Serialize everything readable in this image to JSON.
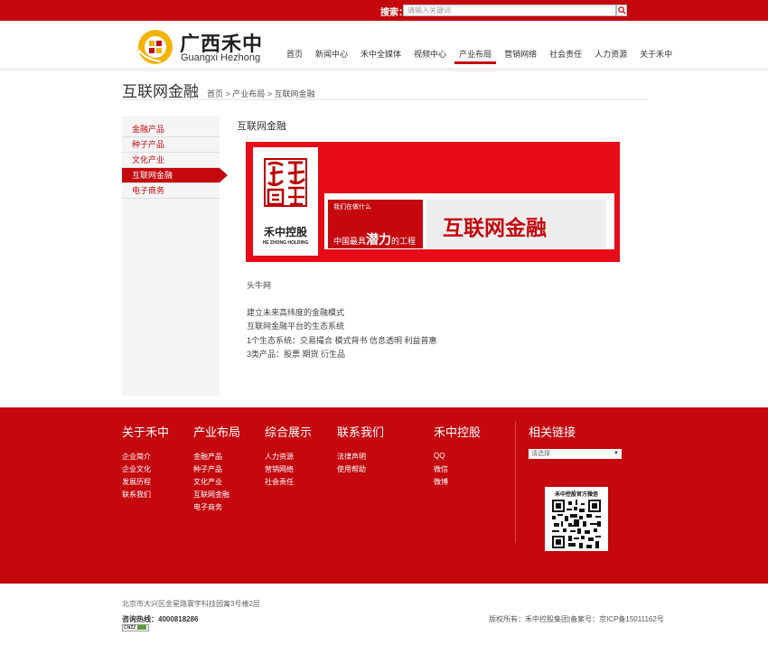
{
  "topbar": {
    "search_label": "搜索：",
    "search_placeholder": "请输入关键词"
  },
  "brand": {
    "name_cn": "广西禾中",
    "name_en": "Guangxi Hezhong",
    "color": "#c4080e",
    "logo_color": "#f2b304"
  },
  "nav": {
    "items": [
      "首页",
      "新闻中心",
      "禾中全媒体",
      "视频中心",
      "产业布局",
      "营销网络",
      "社会责任",
      "人力资源",
      "关于禾中"
    ],
    "active_index": 4
  },
  "page": {
    "heading": "互联网金融",
    "breadcrumb": "首页 > 产业布局 > 互联网金融"
  },
  "sidebar": {
    "items": [
      "金融产品",
      "种子产品",
      "文化产业",
      "互联网金融",
      "电子商务"
    ],
    "active_index": 3
  },
  "content": {
    "title": "互联网金融",
    "banner": {
      "seal_name": "禾中控股",
      "seal_en": "HE ZHONG HOLDING",
      "tag_top": "我们在做什么",
      "tag_main_prefix": "中国最具",
      "tag_main_emph": "潜力",
      "tag_main_suffix": "的工程",
      "headline": "互联网金融"
    },
    "paragraphs": [
      "头牛网",
      "建立未来高纬度的金融模式",
      "互联网金融平台的生态系统",
      "1个生态系统：交易撮合 模式背书 信息透明 利益普惠",
      "3类产品：股票 期货 衍生品"
    ]
  },
  "footer": {
    "columns": [
      {
        "title": "关于禾中",
        "links": [
          "企业简介",
          "企业文化",
          "发展历程",
          "联系我们"
        ]
      },
      {
        "title": "产业布局",
        "links": [
          "金融产品",
          "种子产品",
          "文化产业",
          "互联网金融",
          "电子商务"
        ]
      },
      {
        "title": "综合展示",
        "links": [
          "人力资源",
          "营销网络",
          "社会责任"
        ]
      },
      {
        "title": "联系我们",
        "links": [
          "法律声明",
          "使用帮助"
        ]
      },
      {
        "title": "禾中控股",
        "links": [
          "QQ",
          "微信",
          "微博"
        ]
      }
    ],
    "related_title": "相关链接",
    "select_value": "请选择",
    "qr_title": "禾中控股官方微信"
  },
  "bottom": {
    "address": "北京市大兴区金星路寰宇科技园寓3号楼2层",
    "hotline": "咨询热线：4000818286",
    "cnzz": "CNZZ",
    "copyright": "版权所有：禾中控股集团|备案号：京ICP备15011162号"
  }
}
